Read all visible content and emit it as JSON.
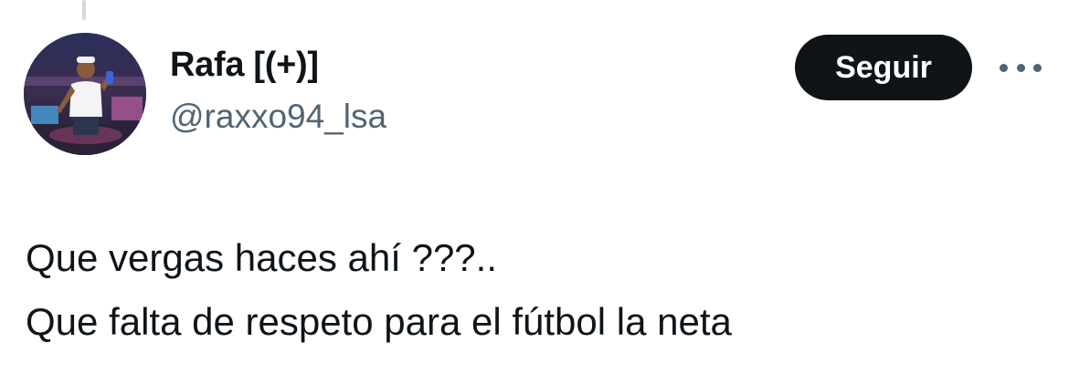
{
  "author": {
    "display_name": "Rafa [(+)]",
    "handle": "@raxxo94_lsa",
    "avatar_icon": "user-photo-avatar"
  },
  "actions": {
    "follow_label": "Seguir",
    "more_icon": "more-horizontal-icon"
  },
  "tweet": {
    "lines": [
      "Que vergas haces ahí ???..",
      "Que falta de respeto para el fútbol la neta"
    ]
  },
  "colors": {
    "text": "#0f1419",
    "secondary_text": "#536471",
    "button_bg": "#0f1419",
    "button_text": "#ffffff"
  }
}
